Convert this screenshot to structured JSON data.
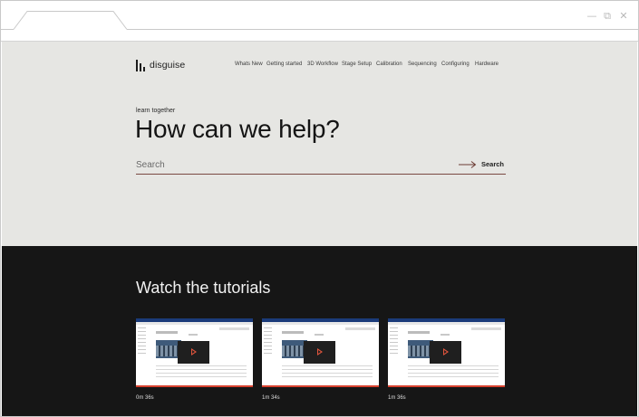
{
  "window": {
    "controls": {
      "minimize": "—",
      "maximize": "⧉",
      "close": "✕"
    }
  },
  "brand": {
    "name": "disguise"
  },
  "nav": {
    "items": [
      "Whats New",
      "Getting started",
      "3D Workflow",
      "Stage Setup",
      "Calibration",
      "Sequencing",
      "Configuring",
      "Hardware"
    ]
  },
  "hero": {
    "eyebrow": "learn together",
    "headline": "How can we help?"
  },
  "search": {
    "placeholder": "Search",
    "button_label": "Search"
  },
  "tutorials": {
    "title": "Watch the tutorials",
    "videos": [
      {
        "duration": "0m 36s"
      },
      {
        "duration": "1m 34s"
      },
      {
        "duration": "1m 36s"
      }
    ]
  },
  "colors": {
    "hero_bg": "#e6e6e3",
    "dark_bg": "#161616",
    "accent": "#d8412f",
    "search_line": "#7a4a42"
  },
  "icons": {
    "logo": "disguise-bars-icon",
    "search": "arrow-right-icon",
    "video": "play-icon"
  }
}
